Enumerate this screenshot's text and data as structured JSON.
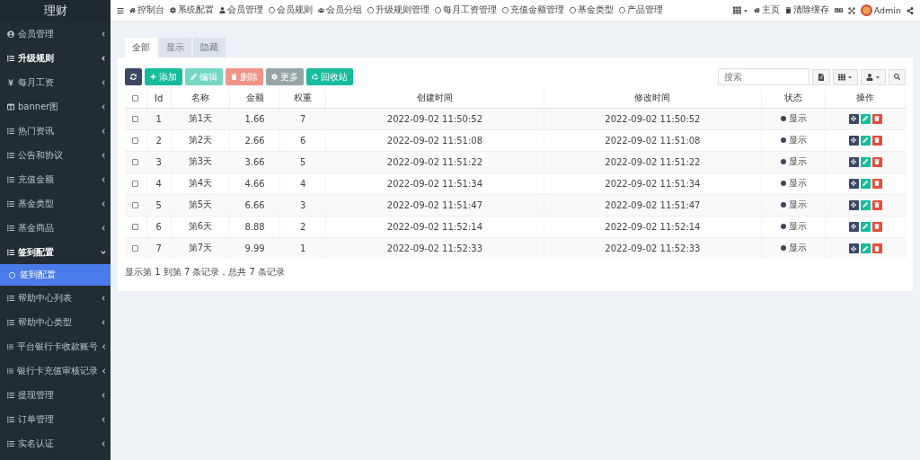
{
  "logo": "理财",
  "sidebar": {
    "items": [
      {
        "label": "会员管理",
        "active": false,
        "expanded": false
      },
      {
        "label": "升级规则",
        "active": true,
        "expanded": false
      },
      {
        "label": "每月工资",
        "active": false,
        "expanded": false
      },
      {
        "label": "banner图",
        "active": false,
        "expanded": false
      },
      {
        "label": "热门资讯",
        "active": false,
        "expanded": false
      },
      {
        "label": "公告和协议",
        "active": false,
        "expanded": false
      },
      {
        "label": "充值金额",
        "active": false,
        "expanded": false
      },
      {
        "label": "基金类型",
        "active": false,
        "expanded": false
      },
      {
        "label": "基金商品",
        "active": false,
        "expanded": false
      },
      {
        "label": "签到配置",
        "active": true,
        "expanded": true,
        "children": [
          {
            "label": "签到配置",
            "selected": true
          }
        ]
      },
      {
        "label": "帮助中心列表",
        "active": false,
        "expanded": false
      },
      {
        "label": "帮助中心类型",
        "active": false,
        "expanded": false
      },
      {
        "label": "平台银行卡收款账号",
        "active": false,
        "expanded": false
      },
      {
        "label": "银行卡充值审核记录",
        "active": false,
        "expanded": false
      },
      {
        "label": "提现管理",
        "active": false,
        "expanded": false
      },
      {
        "label": "订单管理",
        "active": false,
        "expanded": false
      },
      {
        "label": "实名认证",
        "active": false,
        "expanded": false
      }
    ]
  },
  "topnav": {
    "items": [
      {
        "label": "控制台"
      },
      {
        "label": "系统配置"
      },
      {
        "label": "会员管理"
      },
      {
        "label": "会员规则"
      },
      {
        "label": "会员分组"
      },
      {
        "label": "升级规则管理"
      },
      {
        "label": "每月工资管理"
      },
      {
        "label": "充值金额管理"
      },
      {
        "label": "基金类型"
      },
      {
        "label": "产品管理"
      }
    ],
    "right": [
      {
        "label": "主页"
      },
      {
        "label": "清除缓存"
      }
    ],
    "user": "Admin"
  },
  "tabs": [
    {
      "label": "全部",
      "selected": true
    },
    {
      "label": "显示",
      "selected": false
    },
    {
      "label": "隐藏",
      "selected": false
    }
  ],
  "toolbar": [
    {
      "kind": "refresh"
    },
    {
      "kind": "add",
      "label": "添加",
      "disabled": false
    },
    {
      "kind": "edit",
      "label": "编辑",
      "disabled": true
    },
    {
      "kind": "delete",
      "label": "删除",
      "disabled": true
    },
    {
      "kind": "more",
      "label": "更多",
      "disabled": false
    },
    {
      "kind": "recycle",
      "label": "回收站",
      "disabled": false
    }
  ],
  "search": {
    "placeholder": "搜索"
  },
  "table": {
    "all_checked": false,
    "columns": [
      "Id",
      "名称",
      "金额",
      "权重",
      "创建时间",
      "修改时间",
      "状态",
      "操作"
    ],
    "rows": [
      {
        "checked": false,
        "cells": [
          "1",
          "第1天",
          "1.66",
          "7",
          "2022-09-02 11:50:52",
          "2022-09-02 11:50:52",
          "显示"
        ]
      },
      {
        "checked": false,
        "cells": [
          "2",
          "第2天",
          "2.66",
          "6",
          "2022-09-02 11:51:08",
          "2022-09-02 11:51:08",
          "显示"
        ]
      },
      {
        "checked": false,
        "cells": [
          "3",
          "第3天",
          "3.66",
          "5",
          "2022-09-02 11:51:22",
          "2022-09-02 11:51:22",
          "显示"
        ]
      },
      {
        "checked": false,
        "cells": [
          "4",
          "第4天",
          "4.66",
          "4",
          "2022-09-02 11:51:34",
          "2022-09-02 11:51:34",
          "显示"
        ]
      },
      {
        "checked": false,
        "cells": [
          "5",
          "第5天",
          "6.66",
          "3",
          "2022-09-02 11:51:47",
          "2022-09-02 11:51:47",
          "显示"
        ]
      },
      {
        "checked": false,
        "cells": [
          "6",
          "第6天",
          "8.88",
          "2",
          "2022-09-02 11:52:14",
          "2022-09-02 11:52:14",
          "显示"
        ]
      },
      {
        "checked": false,
        "cells": [
          "7",
          "第7天",
          "9.99",
          "1",
          "2022-09-02 11:52:33",
          "2022-09-02 11:52:33",
          "显示"
        ]
      }
    ]
  },
  "footer": "显示第 1 到第 7 条记录，总共 7 条记录"
}
